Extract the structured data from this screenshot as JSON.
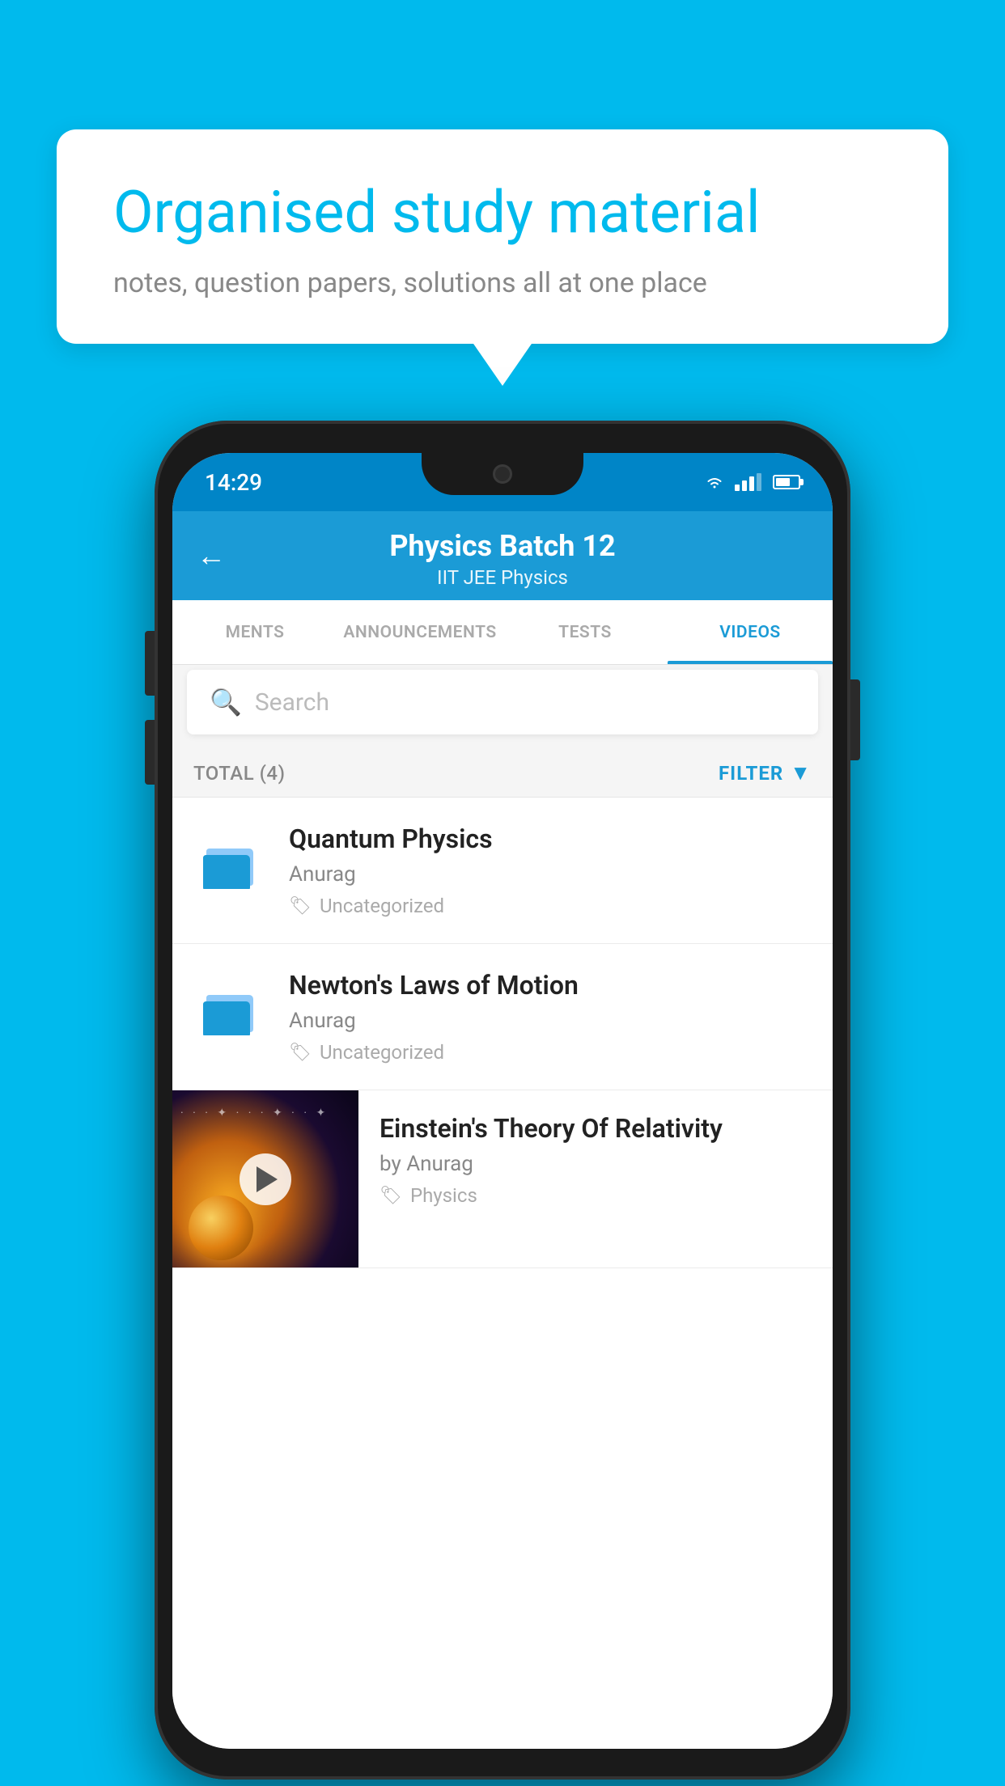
{
  "background": {
    "color": "#00BAED"
  },
  "speech_bubble": {
    "title": "Organised study material",
    "subtitle": "notes, question papers, solutions all at one place"
  },
  "status_bar": {
    "time": "14:29"
  },
  "app_header": {
    "title": "Physics Batch 12",
    "subtitle": "IIT JEE   Physics",
    "back_label": "←"
  },
  "tabs": [
    {
      "label": "MENTS",
      "active": false
    },
    {
      "label": "ANNOUNCEMENTS",
      "active": false
    },
    {
      "label": "TESTS",
      "active": false
    },
    {
      "label": "VIDEOS",
      "active": true
    }
  ],
  "search": {
    "placeholder": "Search"
  },
  "filter_row": {
    "total": "TOTAL (4)",
    "filter_label": "FILTER"
  },
  "videos": [
    {
      "title": "Quantum Physics",
      "author": "Anurag",
      "tag": "Uncategorized",
      "has_thumb": false
    },
    {
      "title": "Newton's Laws of Motion",
      "author": "Anurag",
      "tag": "Uncategorized",
      "has_thumb": false
    },
    {
      "title": "Einstein's Theory Of Relativity",
      "author": "by Anurag",
      "tag": "Physics",
      "has_thumb": true
    }
  ]
}
